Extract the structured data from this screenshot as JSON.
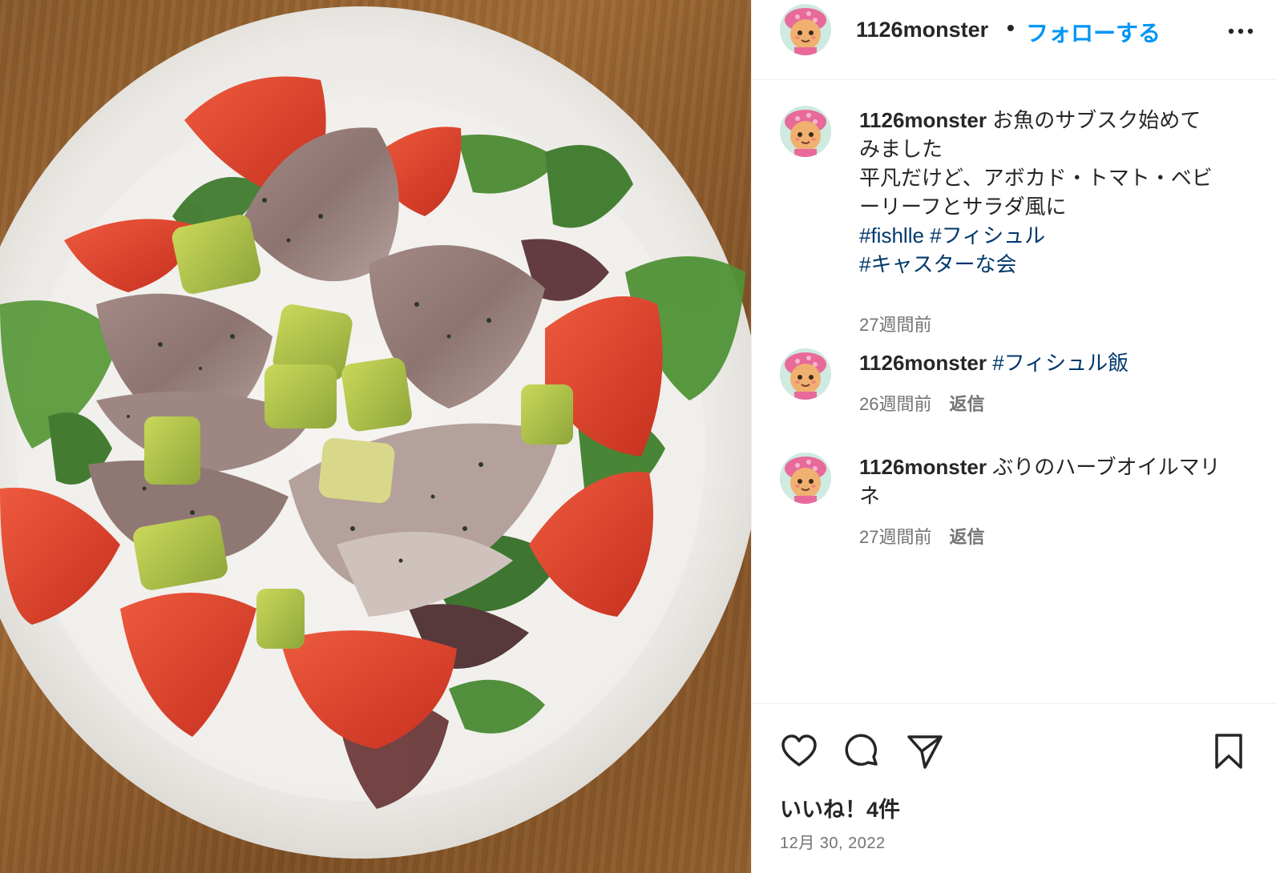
{
  "post": {
    "image_alt": "ぶりのハーブオイルマリネ サラダ",
    "author": "1126monster",
    "follow_label": "フォローする",
    "separator": "•"
  },
  "caption": {
    "username": "1126monster",
    "line1": "お魚のサブスク始めて",
    "line2": "みました",
    "line3": "平凡だけど、アボカド・トマト・ベビ",
    "line4": "ーリーフとサラダ風に",
    "tag1": "#fishlle",
    "tag2": "#フィシュル",
    "tag3": "#キャスターな会",
    "time": "27週間前"
  },
  "comments": [
    {
      "username": "1126monster",
      "text": "#フィシュル飯",
      "time": "26週間前",
      "reply": "返信"
    },
    {
      "username": "1126monster",
      "line1": "ぶりのハーブオイルマリ",
      "line2": "ネ",
      "time": "27週間前",
      "reply": "返信"
    }
  ],
  "icons": {
    "more": "more-options-icon",
    "like": "heart-icon",
    "comment": "comment-icon",
    "share": "share-icon",
    "save": "bookmark-icon"
  },
  "stats": {
    "likes": "いいね！4件",
    "date": "12月 30, 2022"
  },
  "colors": {
    "link": "#0095f6",
    "hashtag": "#00376b",
    "muted": "#737373"
  }
}
